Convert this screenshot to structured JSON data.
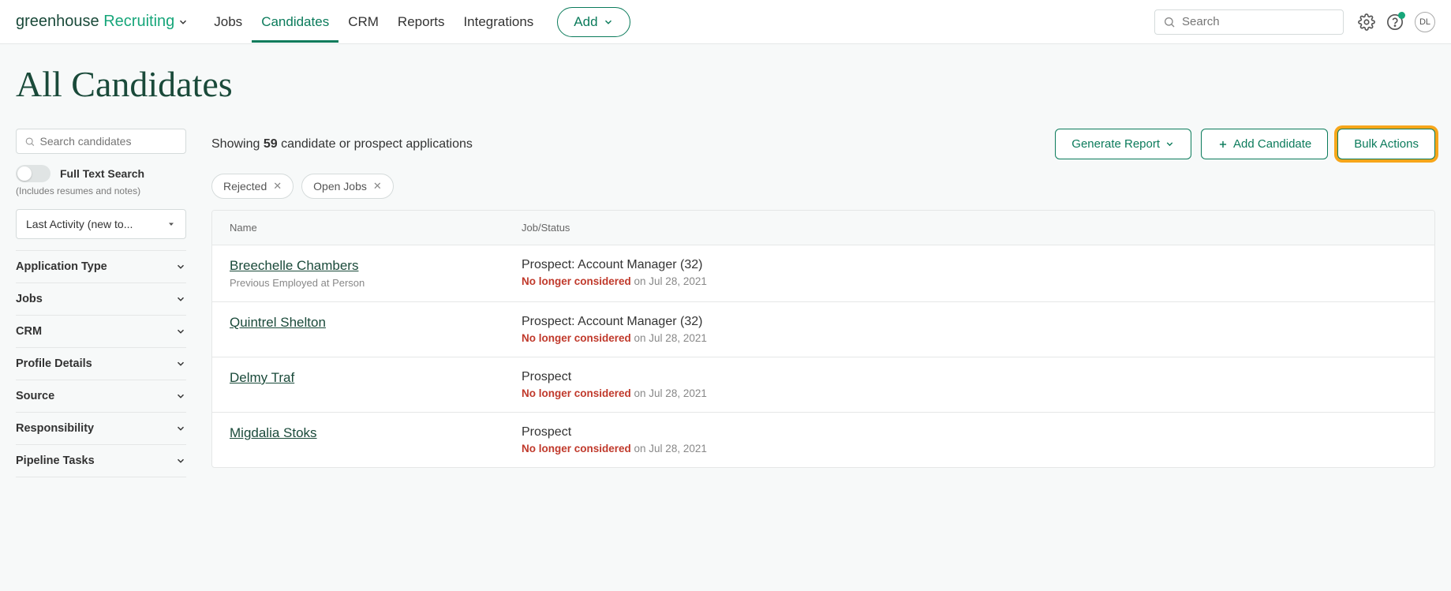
{
  "logo": {
    "part1": "greenhouse",
    "part2": "Recruiting"
  },
  "nav": {
    "jobs": "Jobs",
    "candidates": "Candidates",
    "crm": "CRM",
    "reports": "Reports",
    "integrations": "Integrations",
    "add": "Add"
  },
  "topbar": {
    "search_placeholder": "Search",
    "avatar_initials": "DL"
  },
  "page": {
    "title": "All Candidates"
  },
  "sidebar": {
    "search_placeholder": "Search candidates",
    "toggle_label": "Full Text Search",
    "toggle_sub": "(Includes resumes and notes)",
    "sort_label": "Last Activity (new to...",
    "filters": [
      "Application Type",
      "Jobs",
      "CRM",
      "Profile Details",
      "Source",
      "Responsibility",
      "Pipeline Tasks"
    ]
  },
  "toolbar": {
    "showing_prefix": "Showing ",
    "count": "59",
    "showing_suffix": " candidate or prospect applications",
    "generate_report": "Generate Report",
    "add_candidate": "Add Candidate",
    "bulk_actions": "Bulk Actions"
  },
  "chips": [
    {
      "label": "Rejected"
    },
    {
      "label": "Open Jobs"
    }
  ],
  "table": {
    "headers": {
      "name": "Name",
      "status": "Job/Status"
    },
    "rows": [
      {
        "name": "Breechelle Chambers",
        "sub": "Previous Employed at Person",
        "job": "Prospect: Account Manager (32)",
        "status_text": "No longer considered",
        "status_date": " on Jul 28, 2021"
      },
      {
        "name": "Quintrel Shelton",
        "sub": "",
        "job": "Prospect: Account Manager (32)",
        "status_text": "No longer considered",
        "status_date": " on Jul 28, 2021"
      },
      {
        "name": "Delmy Traf",
        "sub": "",
        "job": "Prospect",
        "status_text": "No longer considered",
        "status_date": " on Jul 28, 2021"
      },
      {
        "name": "Migdalia Stoks",
        "sub": "",
        "job": "Prospect",
        "status_text": "No longer considered",
        "status_date": " on Jul 28, 2021"
      }
    ]
  }
}
